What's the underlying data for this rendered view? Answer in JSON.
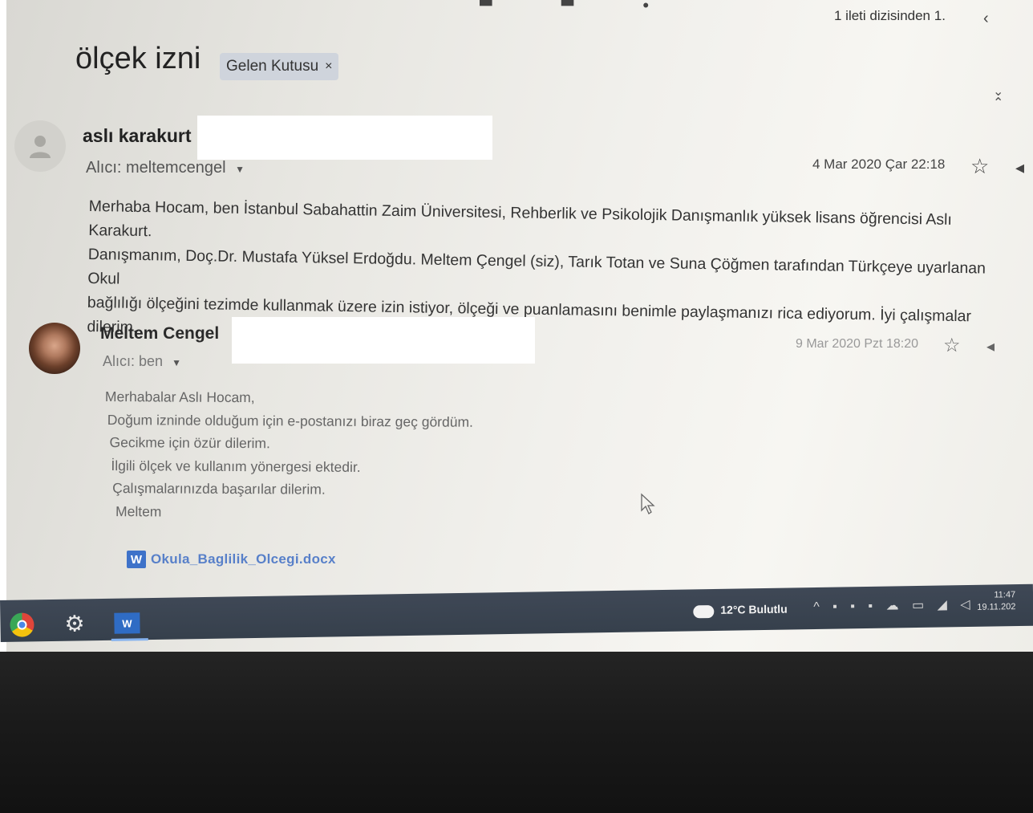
{
  "header": {
    "thread_count": "1 ileti dizisinden 1.",
    "prev_icon": "chevron-left-icon"
  },
  "subject": "ölçek izni",
  "label": {
    "text": "Gelen Kutusu",
    "remove": "×"
  },
  "expand_icon": "unfold-icon",
  "messages": [
    {
      "sender": "aslı karakurt",
      "recipient_prefix": "Alıcı:",
      "recipient": "meltemcengel",
      "date": "4 Mar 2020 Çar 22:18",
      "body": [
        "Merhaba Hocam, ben İstanbul Sabahattin Zaim Üniversitesi, Rehberlik ve Psikolojik Danışmanlık yüksek lisans öğrencisi Aslı Karakurt.",
        "Danışmanım, Doç.Dr. Mustafa Yüksel Erdoğdu. Meltem Çengel (siz), Tarık Totan ve Suna Çöğmen tarafından Türkçeye uyarlanan Okul",
        "bağlılığı ölçeğini tezimde kullanmak üzere izin istiyor, ölçeği ve puanlamasını benimle paylaşmanızı rica ediyorum. İyi çalışmalar dilerim."
      ]
    },
    {
      "sender": "Meltem Cengel",
      "recipient_prefix": "Alıcı:",
      "recipient": "ben",
      "date": "9 Mar 2020 Pzt 18:20",
      "body": [
        "Merhabalar Aslı Hocam,",
        "Doğum izninde olduğum için e-postanızı biraz geç gördüm.",
        "Gecikme için özür dilerim.",
        "İlgili ölçek ve kullanım yönergesi ektedir.",
        "Çalışmalarınızda başarılar dilerim.",
        "Meltem"
      ],
      "attachment": "Okula_Baglilik_Olcegi.docx"
    }
  ],
  "taskbar": {
    "weather": "12°C Bulutlu",
    "time": "11:47",
    "date": "19.11.202"
  },
  "colors": {
    "taskbar": "#3a4350",
    "label_chip": "#cfd4dc",
    "attachment_link": "#5880c9",
    "word_blue": "#2f6cc4"
  }
}
